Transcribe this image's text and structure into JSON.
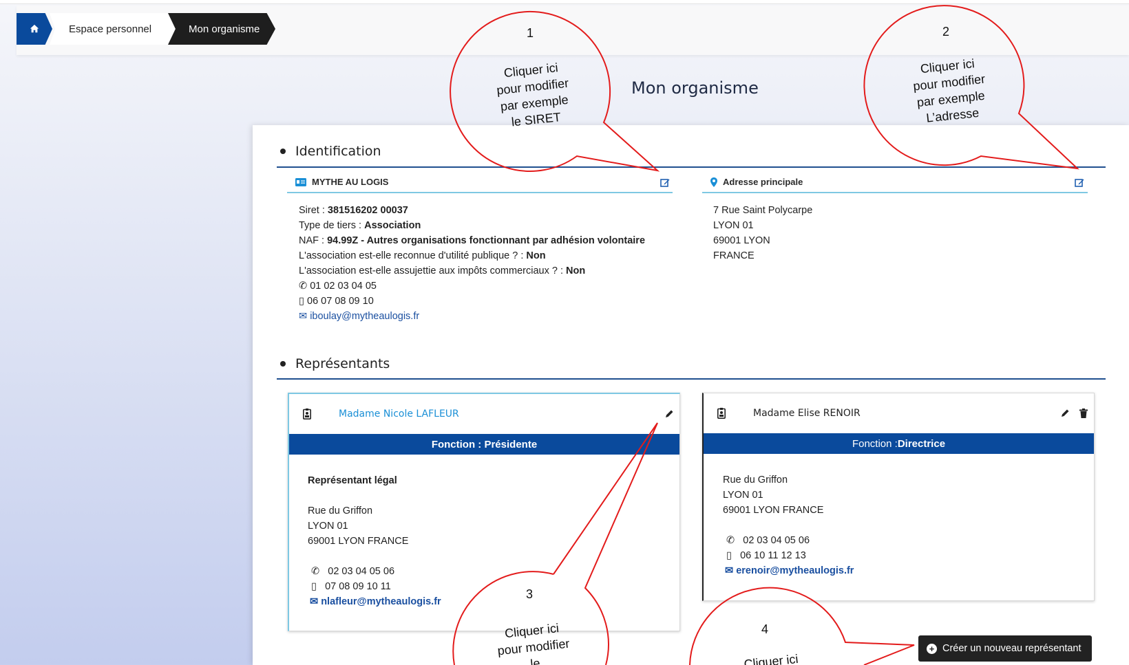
{
  "breadcrumb": {
    "home_icon": "home-icon",
    "items": [
      "Espace personnel",
      "Mon organisme"
    ]
  },
  "page": {
    "title": "Mon organisme"
  },
  "identification": {
    "section_title": "Identification",
    "org": {
      "name": "MYTHE AU LOGIS",
      "siret_label": "Siret : ",
      "siret": "381516202 00037",
      "type_label": "Type de tiers : ",
      "type": "Association",
      "naf_label": "NAF : ",
      "naf": "94.99Z - Autres organisations fonctionnant par adhésion volontaire",
      "utilite_label": "L'association est-elle reconnue d'utilité publique ? : ",
      "utilite": "Non",
      "impots_label": "L'association est-elle assujettie aux impôts commerciaux ? : ",
      "impots": "Non",
      "phone": "01 02 03 04 05",
      "mobile": "06 07 08 09 10",
      "email": "iboulay@mytheaulogis.fr"
    },
    "address": {
      "title": "Adresse principale",
      "line1": "7 Rue Saint Polycarpe",
      "line2": "LYON 01",
      "line3": "69001 LYON",
      "line4": "FRANCE"
    }
  },
  "representants": {
    "section_title": "Représentants",
    "cards": [
      {
        "name": "Madame Nicole LAFLEUR",
        "fonction_label": "Fonction : ",
        "fonction": "Présidente",
        "legal": "Représentant légal",
        "addr1": "Rue du Griffon",
        "addr2": "LYON 01",
        "addr3": "69001 LYON FRANCE",
        "phone": "02 03 04 05 06",
        "mobile": "07 08 09 10 11",
        "email": "nlafleur@mytheaulogis.fr"
      },
      {
        "name": "Madame Elise RENOIR",
        "fonction_label": "Fonction : ",
        "fonction": "Directrice",
        "addr1": "Rue du Griffon",
        "addr2": "LYON 01",
        "addr3": "69001 LYON FRANCE",
        "phone": "02 03 04 05 06",
        "mobile": "06 10 11 12 13",
        "email": "erenoir@mytheaulogis.fr"
      }
    ],
    "create_button": "Créer un nouveau représentant"
  },
  "annotations": [
    {
      "number": "1",
      "lines": [
        "Cliquer ici",
        "pour modifier",
        "par exemple",
        "le SIRET"
      ]
    },
    {
      "number": "2",
      "lines": [
        "Cliquer ici",
        "pour modifier",
        "par exemple",
        "L’adresse"
      ]
    },
    {
      "number": "3",
      "lines": [
        "Cliquer ici",
        "pour modifier",
        "le"
      ]
    },
    {
      "number": "4",
      "lines": [
        "Cliquer ici"
      ]
    }
  ],
  "colors": {
    "primary": "#0a4a9c",
    "accent_line": "#7ec8e3",
    "annotation": "#e31b1b",
    "link": "#1a4fa0"
  }
}
